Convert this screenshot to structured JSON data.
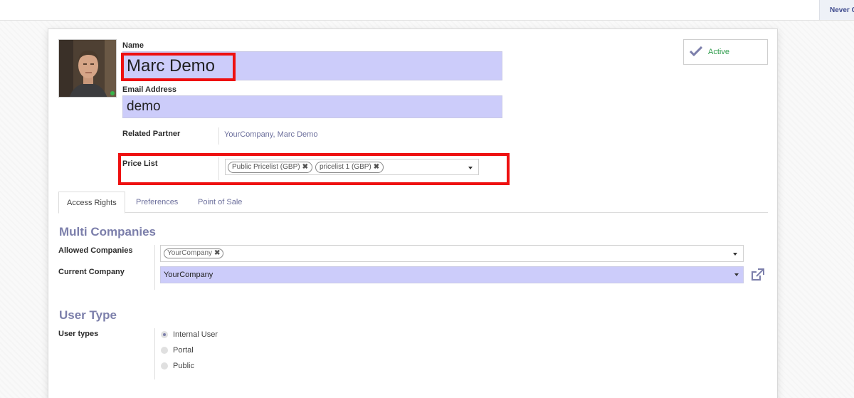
{
  "topbar": {
    "status_text": "Never C"
  },
  "form": {
    "name": {
      "label": "Name",
      "value": "Marc Demo"
    },
    "email": {
      "label": "Email Address",
      "value": "demo"
    },
    "related_partner": {
      "label": "Related Partner",
      "value": "YourCompany, Marc Demo"
    },
    "price_list": {
      "label": "Price List",
      "tags": [
        "Public Pricelist (GBP)",
        "pricelist 1 (GBP)"
      ]
    },
    "active_button": {
      "label": "Active"
    }
  },
  "tabs": [
    {
      "label": "Access Rights",
      "active": true
    },
    {
      "label": "Preferences",
      "active": false
    },
    {
      "label": "Point of Sale",
      "active": false
    }
  ],
  "multi_companies": {
    "title": "Multi Companies",
    "allowed_label": "Allowed Companies",
    "allowed_tags": [
      "YourCompany"
    ],
    "current_label": "Current Company",
    "current_value": "YourCompany"
  },
  "user_type": {
    "title": "User Type",
    "label": "User types",
    "options": [
      {
        "label": "Internal User",
        "checked": true
      },
      {
        "label": "Portal",
        "checked": false
      },
      {
        "label": "Public",
        "checked": false
      }
    ]
  },
  "colors": {
    "accent": "#7c7fab",
    "highlight_field": "#ccccfa",
    "annotation_red": "#ee1010",
    "active_green": "#2e9c4b"
  },
  "icons": {
    "active": "check-icon",
    "external": "external-link-icon",
    "dropdown": "caret-down-icon",
    "remove_tag": "close-icon"
  }
}
